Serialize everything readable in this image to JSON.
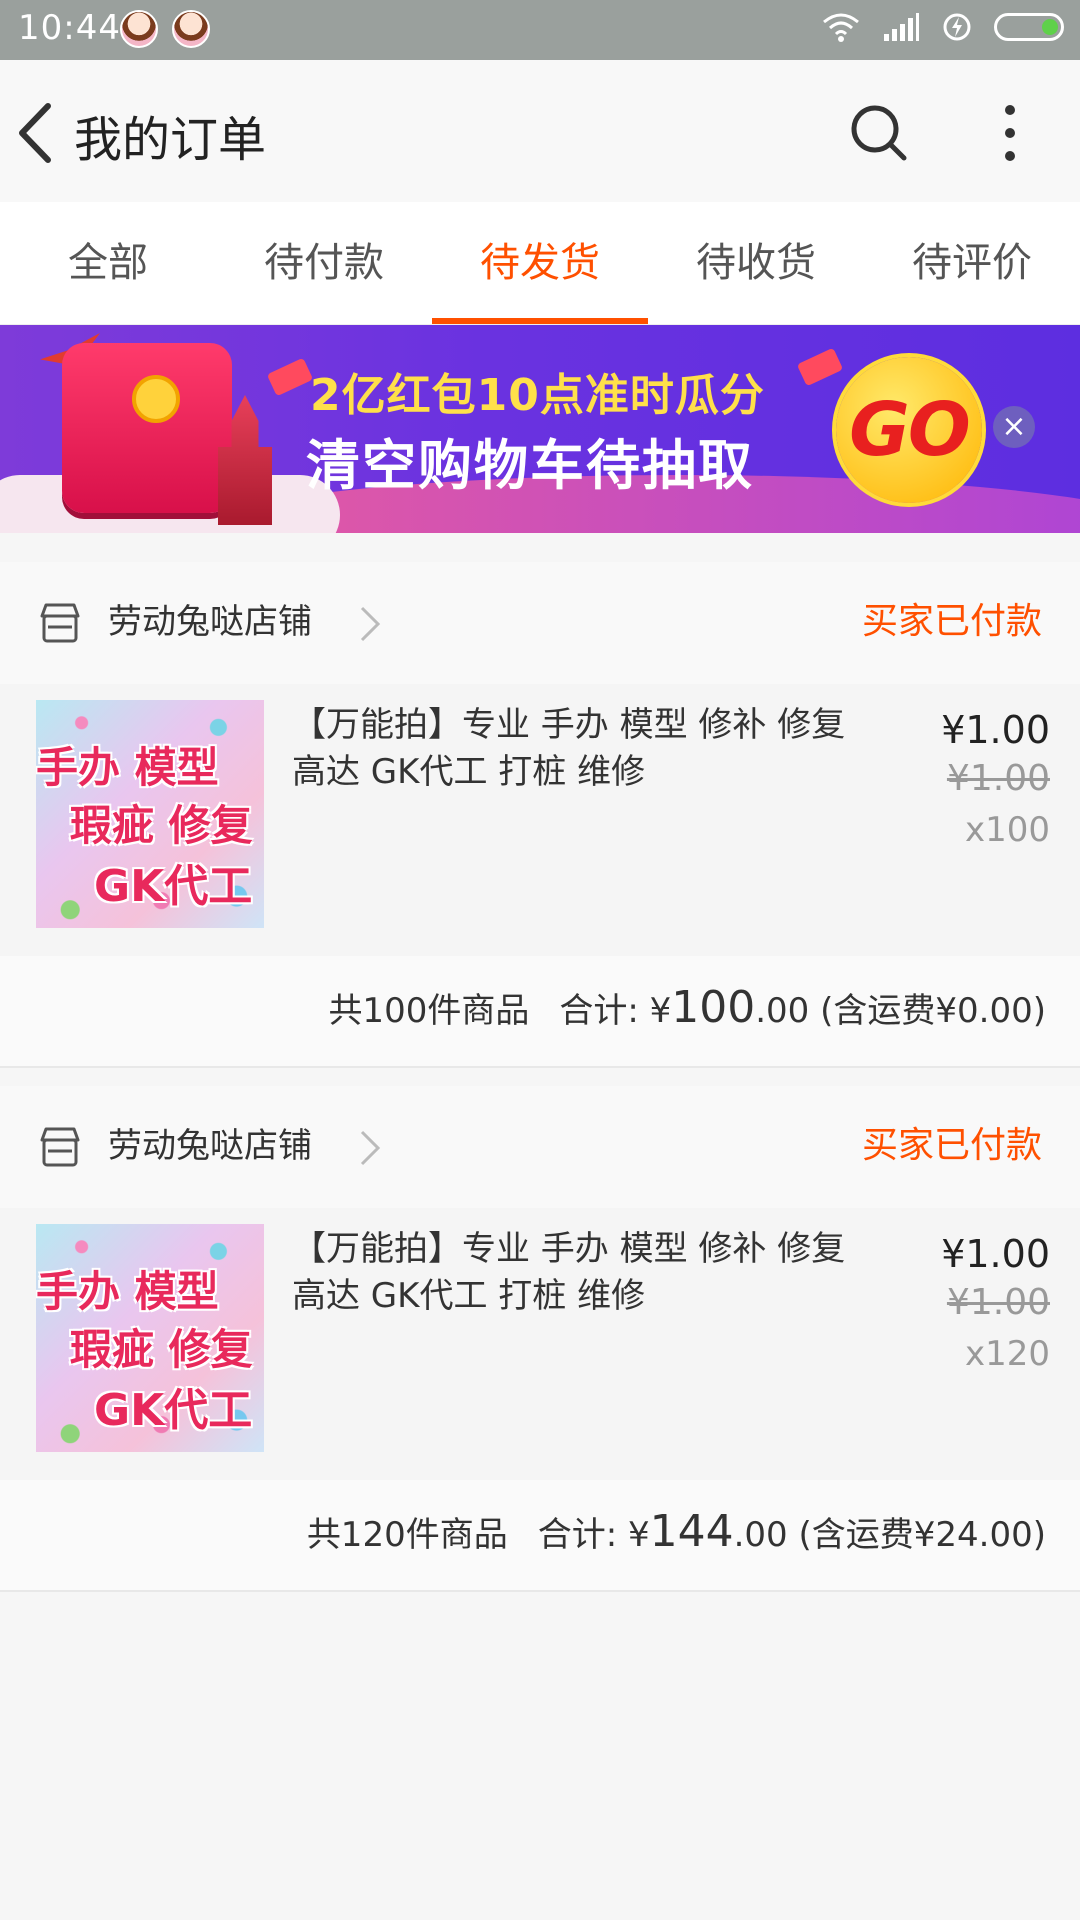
{
  "status_bar": {
    "time": "10:44"
  },
  "header": {
    "title": "我的订单"
  },
  "tabs": [
    {
      "label": "全部"
    },
    {
      "label": "待付款"
    },
    {
      "label": "待发货",
      "active": true
    },
    {
      "label": "待收货"
    },
    {
      "label": "待评价"
    }
  ],
  "banner": {
    "line1": "2亿红包10点准时瓜分",
    "line2": "清空购物车待抽取",
    "go": "GO",
    "close": "×"
  },
  "orders": [
    {
      "shop": "劳动兔哒店铺",
      "status": "买家已付款",
      "item": {
        "title": "【万能拍】专业 手办 模型 修补 修复 高达 GK代工 打桩 维修",
        "thumb_text": [
          "手办 模型",
          "瑕疵 修复",
          "GK代工"
        ],
        "price": "¥1.00",
        "original_price": "¥1.00",
        "quantity": "x100"
      },
      "summary": {
        "count": "共100件商品",
        "total_label": "合计: ¥",
        "total_int": "100",
        "total_dec": ".00",
        "shipping": "(含运费¥0.00)"
      }
    },
    {
      "shop": "劳动兔哒店铺",
      "status": "买家已付款",
      "item": {
        "title": "【万能拍】专业 手办 模型 修补 修复 高达 GK代工 打桩 维修",
        "thumb_text": [
          "手办 模型",
          "瑕疵 修复",
          "GK代工"
        ],
        "price": "¥1.00",
        "original_price": "¥1.00",
        "quantity": "x120"
      },
      "summary": {
        "count": "共120件商品",
        "total_label": "合计: ¥",
        "total_int": "144",
        "total_dec": ".00",
        "shipping": "(含运费¥24.00)"
      }
    }
  ],
  "colors": {
    "accent": "#ff5000",
    "status_bar": "#9aa09d",
    "battery": "#5fd14a"
  },
  "icons": [
    "back-arrow-icon",
    "search-icon",
    "more-vertical-icon",
    "shop-icon",
    "chevron-right-icon",
    "wifi-icon",
    "signal-icon",
    "charging-icon",
    "battery-icon"
  ]
}
